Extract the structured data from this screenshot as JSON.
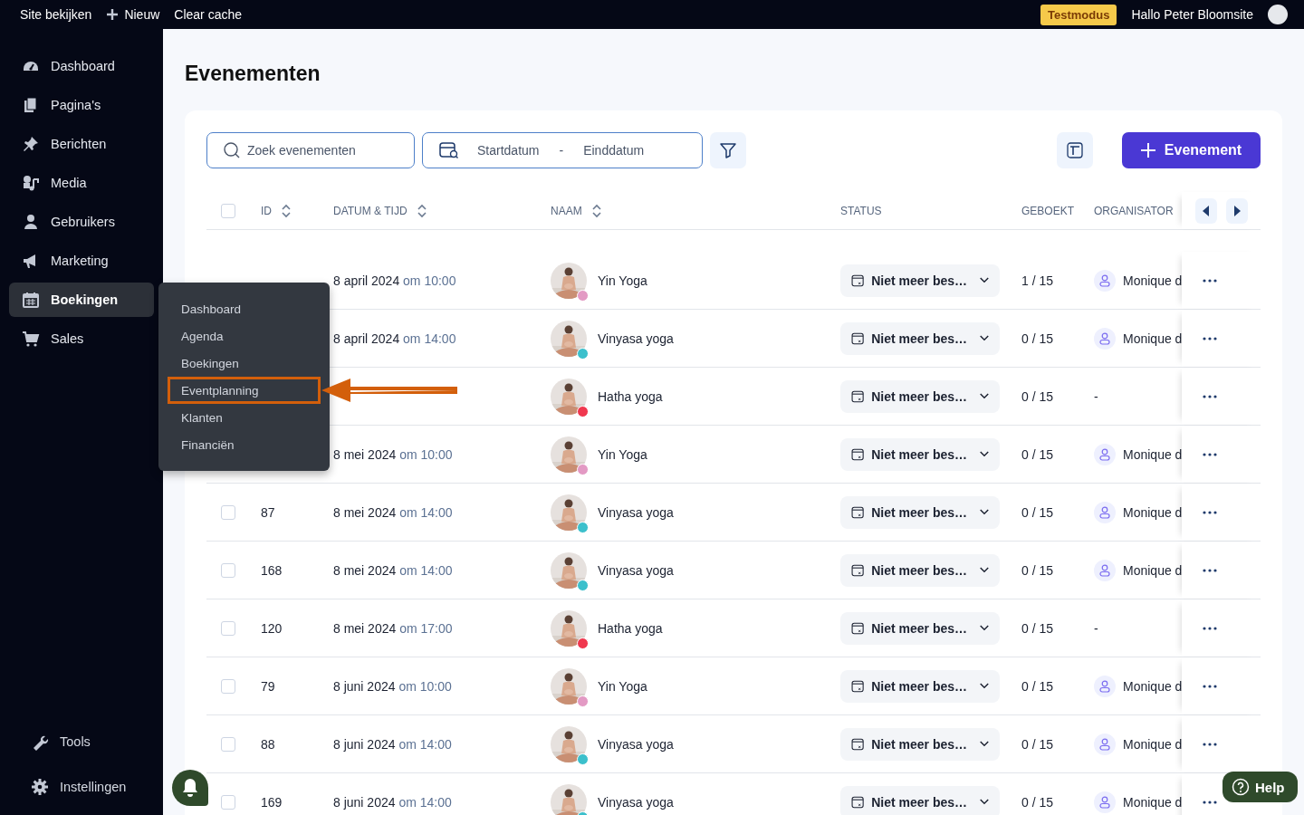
{
  "top_bar": {
    "links": [
      "Site bekijken",
      "Nieuw",
      "Clear cache"
    ],
    "badge": "Testmodus",
    "greeting": "Hallo Peter Bloomsite"
  },
  "sidebar": {
    "items": [
      {
        "label": "Dashboard",
        "selected": false
      },
      {
        "label": "Pagina's",
        "selected": false
      },
      {
        "label": "Berichten",
        "selected": false
      },
      {
        "label": "Media",
        "selected": false
      },
      {
        "label": "Gebruikers",
        "selected": false
      },
      {
        "label": "Marketing",
        "selected": false
      },
      {
        "label": "Boekingen",
        "selected": true
      },
      {
        "label": "Sales",
        "selected": false
      }
    ],
    "bottom_items": [
      "Tools",
      "Instellingen"
    ]
  },
  "flyout": {
    "items": [
      {
        "label": "Dashboard",
        "highlighted": false
      },
      {
        "label": "Agenda",
        "highlighted": false
      },
      {
        "label": "Boekingen",
        "highlighted": false
      },
      {
        "label": "Eventplanning",
        "highlighted": true
      },
      {
        "label": "Klanten",
        "highlighted": false
      },
      {
        "label": "Financiën",
        "highlighted": false
      }
    ]
  },
  "page_title": "Evenementen",
  "toolbar": {
    "search": {
      "placeholder": "Zoek evenementen"
    },
    "date_range": {
      "start": "Startdatum",
      "separator": "-",
      "end": "Einddatum"
    },
    "add_button": "Evenement"
  },
  "table": {
    "select_all_checked": false,
    "columns": [
      "ID",
      "DATUM & TIJD",
      "NAAM",
      "STATUS",
      "GEBOEKT",
      "ORGANISATOR"
    ],
    "rows": [
      {
        "date": "8 april 2024",
        "time": "om 10:00",
        "name": "Yin Yoga",
        "color": "#e39ac4",
        "status": "Niet meer bes…",
        "booked": "1 / 15",
        "organizer": {
          "kind": "person",
          "name": "Monique d"
        }
      },
      {
        "date": "8 april 2024",
        "time": "om 14:00",
        "name": "Vinyasa yoga",
        "color": "#3cc0cc",
        "status": "Niet meer bes…",
        "booked": "0 / 15",
        "organizer": {
          "kind": "person",
          "name": "Monique d"
        }
      },
      {
        "name": "Hatha yoga",
        "color": "#f0384f",
        "status": "Niet meer bes…",
        "booked": "0 / 15",
        "organizer": {
          "kind": "empty",
          "name": "-"
        }
      },
      {
        "date": "8 mei 2024",
        "time": "om 10:00",
        "name": "Yin Yoga",
        "color": "#e39ac4",
        "status": "Niet meer bes…",
        "booked": "0 / 15",
        "organizer": {
          "kind": "person",
          "name": "Monique d"
        }
      },
      {
        "checked": false,
        "id": "87",
        "date": "8 mei 2024",
        "time": "om 14:00",
        "name": "Vinyasa yoga",
        "color": "#3cc0cc",
        "status": "Niet meer bes…",
        "booked": "0 / 15",
        "organizer": {
          "kind": "person",
          "name": "Monique d"
        }
      },
      {
        "checked": false,
        "id": "168",
        "date": "8 mei 2024",
        "time": "om 14:00",
        "name": "Vinyasa yoga",
        "color": "#3cc0cc",
        "status": "Niet meer bes…",
        "booked": "0 / 15",
        "organizer": {
          "kind": "person",
          "name": "Monique d"
        }
      },
      {
        "checked": false,
        "id": "120",
        "date": "8 mei 2024",
        "time": "om 17:00",
        "name": "Hatha yoga",
        "color": "#f0384f",
        "status": "Niet meer bes…",
        "booked": "0 / 15",
        "organizer": {
          "kind": "empty",
          "name": "-"
        }
      },
      {
        "checked": false,
        "id": "79",
        "date": "8 juni 2024",
        "time": "om 10:00",
        "name": "Yin Yoga",
        "color": "#e39ac4",
        "status": "Niet meer bes…",
        "booked": "0 / 15",
        "organizer": {
          "kind": "person",
          "name": "Monique d"
        }
      },
      {
        "checked": false,
        "id": "88",
        "date": "8 juni 2024",
        "time": "om 14:00",
        "name": "Vinyasa yoga",
        "color": "#3cc0cc",
        "status": "Niet meer bes…",
        "booked": "0 / 15",
        "organizer": {
          "kind": "person",
          "name": "Monique d"
        }
      },
      {
        "checked": false,
        "id": "169",
        "date": "8 juni 2024",
        "time": "om 14:00",
        "name": "Vinyasa yoga",
        "color": "#3cc0cc",
        "status": "Niet meer bes…",
        "booked": "0 / 15",
        "organizer": {
          "kind": "person",
          "name": "Monique d"
        }
      }
    ]
  },
  "help_button": "Help"
}
